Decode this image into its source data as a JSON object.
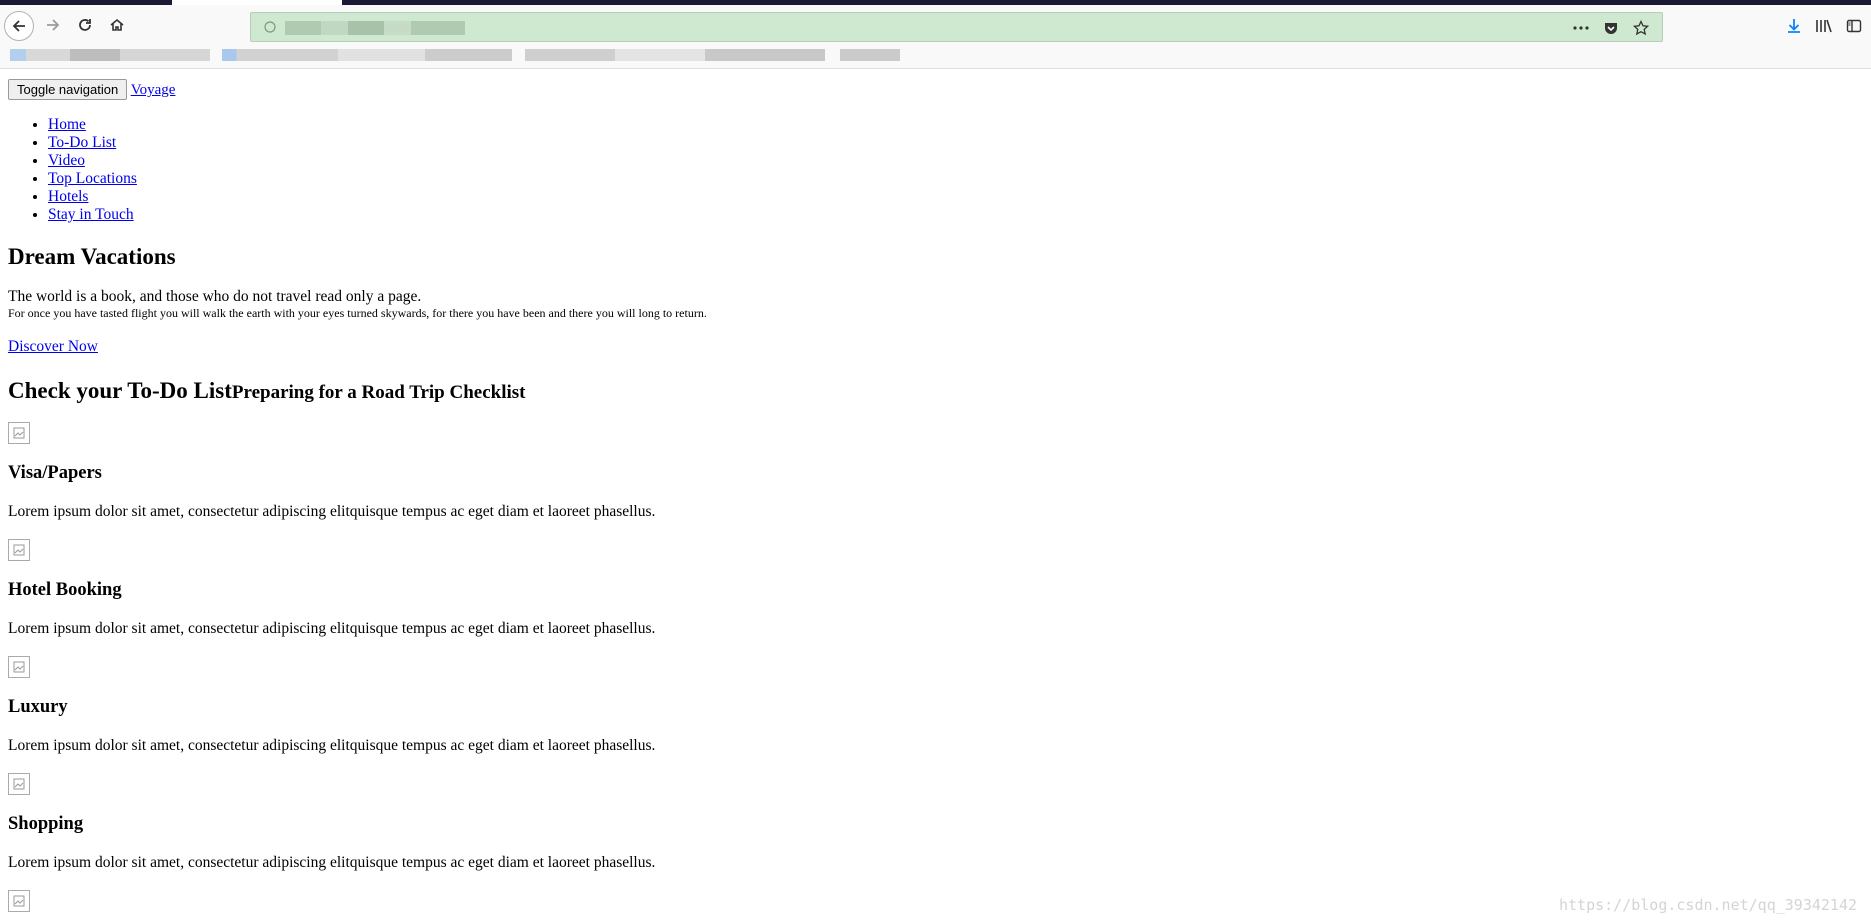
{
  "browser": {
    "url_display": "",
    "icons": {
      "back": "back-arrow-icon",
      "forward": "forward-arrow-icon",
      "reload": "reload-icon",
      "home": "home-icon",
      "more": "more-icon",
      "pocket": "pocket-icon",
      "bookmark_star": "star-icon",
      "download": "download-icon",
      "library": "library-icon",
      "sidebar": "sidebar-icon"
    },
    "colors": {
      "urlbar_bg": "#cfe9d0",
      "tab_dark": "#1b1a34",
      "download_blue": "#0a84ff"
    }
  },
  "page": {
    "toggle_button": "Toggle navigation",
    "brand": "Voyage",
    "menu": [
      {
        "label": "Home"
      },
      {
        "label": "To-Do List"
      },
      {
        "label": "Video"
      },
      {
        "label": "Top Locations"
      },
      {
        "label": "Hotels"
      },
      {
        "label": "Stay in Touch"
      }
    ],
    "hero": {
      "title": "Dream Vacations",
      "quote": "The world is a book, and those who do not travel read only a page.",
      "subquote": "For once you have tasted flight you will walk the earth with your eyes turned skywards, for there you have been and there you will long to return.",
      "cta": "Discover Now"
    },
    "todo": {
      "title": "Check your To-Do List",
      "subtitle": "Preparing for a Road Trip Checklist",
      "items": [
        {
          "title": "Visa/Papers",
          "text": "Lorem ipsum dolor sit amet, consectetur adipiscing elitquisque tempus ac eget diam et laoreet phasellus."
        },
        {
          "title": "Hotel Booking",
          "text": "Lorem ipsum dolor sit amet, consectetur adipiscing elitquisque tempus ac eget diam et laoreet phasellus."
        },
        {
          "title": "Luxury",
          "text": "Lorem ipsum dolor sit amet, consectetur adipiscing elitquisque tempus ac eget diam et laoreet phasellus."
        },
        {
          "title": "Shopping",
          "text": "Lorem ipsum dolor sit amet, consectetur adipiscing elitquisque tempus ac eget diam et laoreet phasellus."
        }
      ]
    }
  },
  "watermark": "https://blog.csdn.net/qq_39342142"
}
